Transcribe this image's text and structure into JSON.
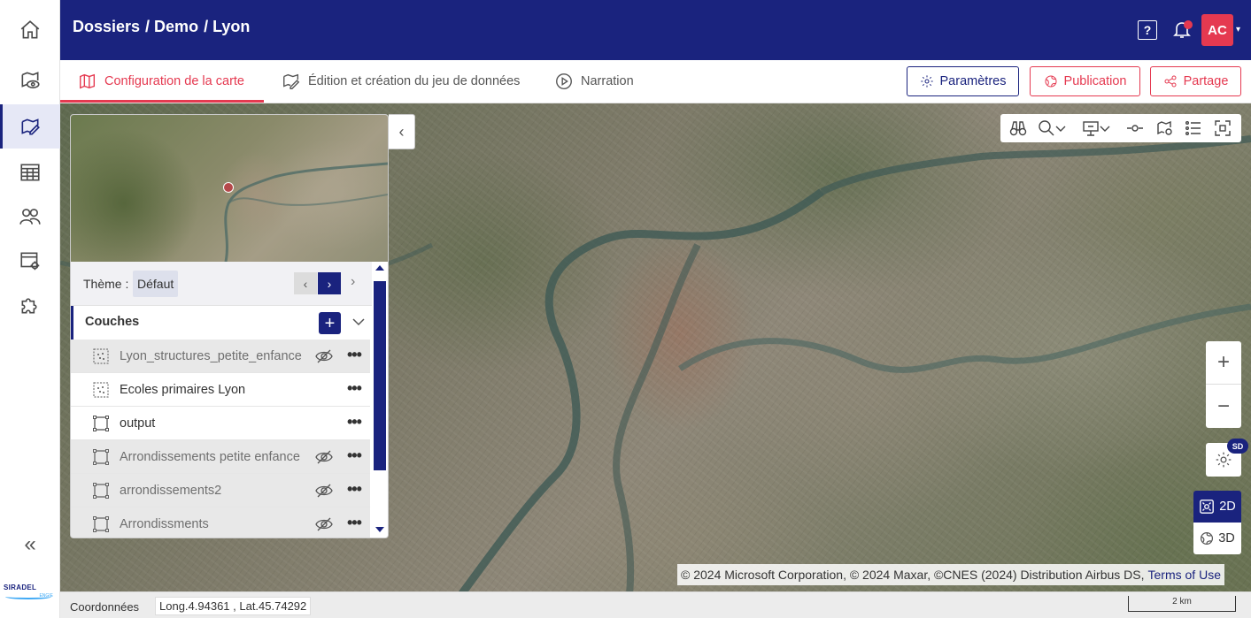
{
  "header": {
    "breadcrumb": [
      "Dossiers",
      "/ Demo",
      "/ Lyon"
    ],
    "help_label": "?",
    "avatar_initials": "AC",
    "accent_color": "#1a237e",
    "alert_color": "#e53950"
  },
  "rail": {
    "items": [
      {
        "icon": "home-icon"
      },
      {
        "icon": "map-view-icon"
      },
      {
        "icon": "map-edit-icon",
        "active": true
      },
      {
        "icon": "table-icon"
      },
      {
        "icon": "users-icon"
      },
      {
        "icon": "app-settings-icon"
      },
      {
        "icon": "puzzle-icon"
      }
    ],
    "collapse_label": "«",
    "logo_text": "SIRADEL",
    "logo_sub": "ENGIE"
  },
  "tabs": [
    {
      "label": "Configuration de la carte",
      "active": true
    },
    {
      "label": "Édition et création du jeu de données",
      "active": false
    },
    {
      "label": "Narration",
      "active": false
    }
  ],
  "actions": {
    "params_label": "Paramètres",
    "publication_label": "Publication",
    "share_label": "Partage"
  },
  "panel": {
    "theme_label": "Thème :",
    "theme_value": "Défaut",
    "layers_title": "Couches",
    "layers": [
      {
        "name": "Lyon_structures_petite_enfance",
        "type": "points",
        "visible": false
      },
      {
        "name": "Ecoles primaires Lyon",
        "type": "points",
        "visible": true
      },
      {
        "name": "output",
        "type": "polygon",
        "visible": true
      },
      {
        "name": "Arrondissements petite enfance",
        "type": "polygon",
        "visible": false
      },
      {
        "name": "arrondissements2",
        "type": "polygon",
        "visible": false
      },
      {
        "name": "Arrondissments",
        "type": "polygon",
        "visible": false
      }
    ]
  },
  "map": {
    "attribution": "© 2024 Microsoft Corporation, © 2024 Maxar, ©CNES (2024) Distribution Airbus DS,",
    "terms_label": "Terms of Use",
    "quality_badge": "SD",
    "view_2d_label": "2D",
    "view_3d_label": "3D",
    "zoom_in_label": "+",
    "zoom_out_label": "−"
  },
  "status": {
    "coords_label": "Coordonnées",
    "coords_value": "Long.4.94361 , Lat.45.74292",
    "scale_label": "2 km"
  }
}
